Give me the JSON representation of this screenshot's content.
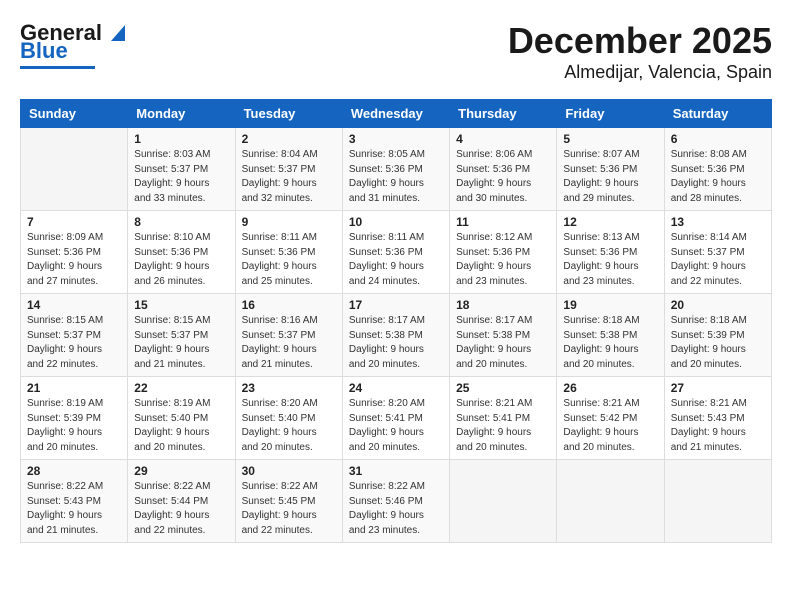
{
  "header": {
    "logo_general": "General",
    "logo_blue": "Blue",
    "title": "December 2025",
    "subtitle": "Almedijar, Valencia, Spain"
  },
  "weekdays": [
    "Sunday",
    "Monday",
    "Tuesday",
    "Wednesday",
    "Thursday",
    "Friday",
    "Saturday"
  ],
  "weeks": [
    [
      {
        "day": "",
        "sunrise": "",
        "sunset": "",
        "daylight": ""
      },
      {
        "day": "1",
        "sunrise": "8:03 AM",
        "sunset": "5:37 PM",
        "daylight": "9 hours and 33 minutes."
      },
      {
        "day": "2",
        "sunrise": "8:04 AM",
        "sunset": "5:37 PM",
        "daylight": "9 hours and 32 minutes."
      },
      {
        "day": "3",
        "sunrise": "8:05 AM",
        "sunset": "5:36 PM",
        "daylight": "9 hours and 31 minutes."
      },
      {
        "day": "4",
        "sunrise": "8:06 AM",
        "sunset": "5:36 PM",
        "daylight": "9 hours and 30 minutes."
      },
      {
        "day": "5",
        "sunrise": "8:07 AM",
        "sunset": "5:36 PM",
        "daylight": "9 hours and 29 minutes."
      },
      {
        "day": "6",
        "sunrise": "8:08 AM",
        "sunset": "5:36 PM",
        "daylight": "9 hours and 28 minutes."
      }
    ],
    [
      {
        "day": "7",
        "sunrise": "8:09 AM",
        "sunset": "5:36 PM",
        "daylight": "9 hours and 27 minutes."
      },
      {
        "day": "8",
        "sunrise": "8:10 AM",
        "sunset": "5:36 PM",
        "daylight": "9 hours and 26 minutes."
      },
      {
        "day": "9",
        "sunrise": "8:11 AM",
        "sunset": "5:36 PM",
        "daylight": "9 hours and 25 minutes."
      },
      {
        "day": "10",
        "sunrise": "8:11 AM",
        "sunset": "5:36 PM",
        "daylight": "9 hours and 24 minutes."
      },
      {
        "day": "11",
        "sunrise": "8:12 AM",
        "sunset": "5:36 PM",
        "daylight": "9 hours and 23 minutes."
      },
      {
        "day": "12",
        "sunrise": "8:13 AM",
        "sunset": "5:36 PM",
        "daylight": "9 hours and 23 minutes."
      },
      {
        "day": "13",
        "sunrise": "8:14 AM",
        "sunset": "5:37 PM",
        "daylight": "9 hours and 22 minutes."
      }
    ],
    [
      {
        "day": "14",
        "sunrise": "8:15 AM",
        "sunset": "5:37 PM",
        "daylight": "9 hours and 22 minutes."
      },
      {
        "day": "15",
        "sunrise": "8:15 AM",
        "sunset": "5:37 PM",
        "daylight": "9 hours and 21 minutes."
      },
      {
        "day": "16",
        "sunrise": "8:16 AM",
        "sunset": "5:37 PM",
        "daylight": "9 hours and 21 minutes."
      },
      {
        "day": "17",
        "sunrise": "8:17 AM",
        "sunset": "5:38 PM",
        "daylight": "9 hours and 20 minutes."
      },
      {
        "day": "18",
        "sunrise": "8:17 AM",
        "sunset": "5:38 PM",
        "daylight": "9 hours and 20 minutes."
      },
      {
        "day": "19",
        "sunrise": "8:18 AM",
        "sunset": "5:38 PM",
        "daylight": "9 hours and 20 minutes."
      },
      {
        "day": "20",
        "sunrise": "8:18 AM",
        "sunset": "5:39 PM",
        "daylight": "9 hours and 20 minutes."
      }
    ],
    [
      {
        "day": "21",
        "sunrise": "8:19 AM",
        "sunset": "5:39 PM",
        "daylight": "9 hours and 20 minutes."
      },
      {
        "day": "22",
        "sunrise": "8:19 AM",
        "sunset": "5:40 PM",
        "daylight": "9 hours and 20 minutes."
      },
      {
        "day": "23",
        "sunrise": "8:20 AM",
        "sunset": "5:40 PM",
        "daylight": "9 hours and 20 minutes."
      },
      {
        "day": "24",
        "sunrise": "8:20 AM",
        "sunset": "5:41 PM",
        "daylight": "9 hours and 20 minutes."
      },
      {
        "day": "25",
        "sunrise": "8:21 AM",
        "sunset": "5:41 PM",
        "daylight": "9 hours and 20 minutes."
      },
      {
        "day": "26",
        "sunrise": "8:21 AM",
        "sunset": "5:42 PM",
        "daylight": "9 hours and 20 minutes."
      },
      {
        "day": "27",
        "sunrise": "8:21 AM",
        "sunset": "5:43 PM",
        "daylight": "9 hours and 21 minutes."
      }
    ],
    [
      {
        "day": "28",
        "sunrise": "8:22 AM",
        "sunset": "5:43 PM",
        "daylight": "9 hours and 21 minutes."
      },
      {
        "day": "29",
        "sunrise": "8:22 AM",
        "sunset": "5:44 PM",
        "daylight": "9 hours and 22 minutes."
      },
      {
        "day": "30",
        "sunrise": "8:22 AM",
        "sunset": "5:45 PM",
        "daylight": "9 hours and 22 minutes."
      },
      {
        "day": "31",
        "sunrise": "8:22 AM",
        "sunset": "5:46 PM",
        "daylight": "9 hours and 23 minutes."
      },
      {
        "day": "",
        "sunrise": "",
        "sunset": "",
        "daylight": ""
      },
      {
        "day": "",
        "sunrise": "",
        "sunset": "",
        "daylight": ""
      },
      {
        "day": "",
        "sunrise": "",
        "sunset": "",
        "daylight": ""
      }
    ]
  ]
}
